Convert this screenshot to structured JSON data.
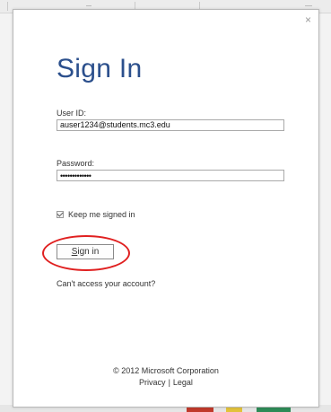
{
  "dialog": {
    "close_glyph": "×",
    "title": "Sign In",
    "userid_label": "User ID:",
    "userid_value": "auser1234@students.mc3.edu",
    "password_label": "Password:",
    "password_value": "•••••••••••••",
    "keep_signed_in_label": "Keep me signed in",
    "keep_signed_in_checked": true,
    "signin_button_first": "S",
    "signin_button_rest": "ign in",
    "cant_access": "Can't access your account?",
    "copyright": "© 2012 Microsoft Corporation",
    "privacy": "Privacy",
    "legal": "Legal",
    "separator": "|"
  },
  "colors": {
    "title": "#2b4f8c",
    "highlight_circle": "#e02020"
  }
}
